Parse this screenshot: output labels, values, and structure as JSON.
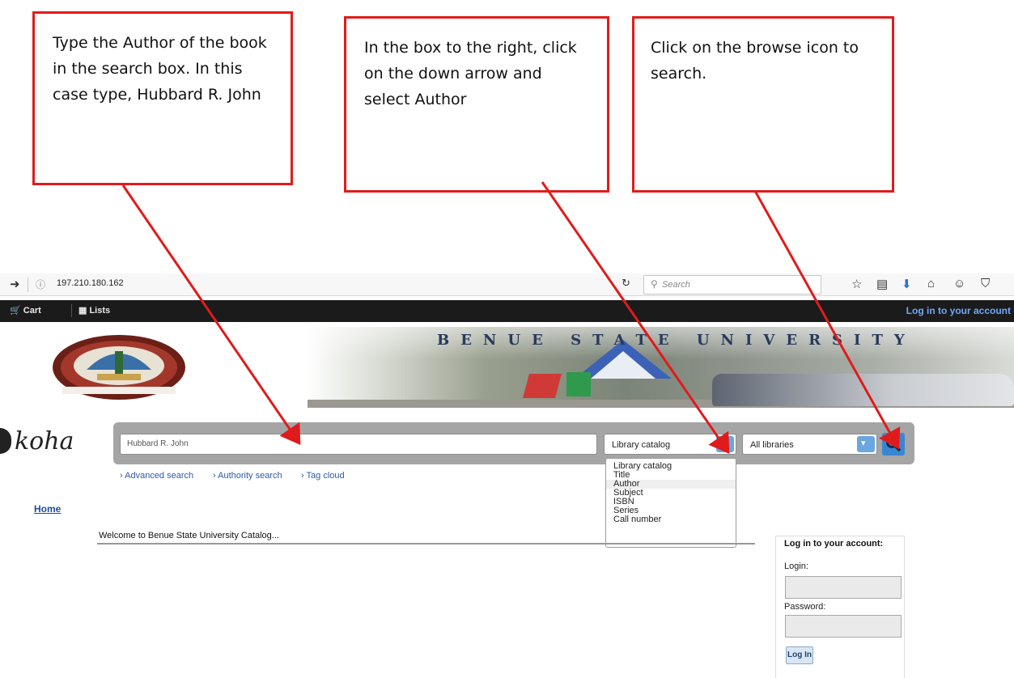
{
  "callouts": {
    "author_search": "Type the Author of the book in the search box. In this case type, Hubbard R. John",
    "select_author": "In the box to the right, click on the down arrow and select Author",
    "browse_icon": "Click on the browse icon to search."
  },
  "browser": {
    "url": "197.210.180.162",
    "search_placeholder": "Search",
    "toolbar_icons": [
      "forward-icon",
      "info-icon",
      "reload-icon",
      "bookmark-star-icon",
      "reading-list-icon",
      "download-icon",
      "home-icon",
      "chat-icon",
      "pocket-icon"
    ]
  },
  "topbar": {
    "cart": "Cart",
    "lists": "Lists",
    "login": "Log in to your account"
  },
  "banner": {
    "title": "BENUE STATE UNIVERSITY"
  },
  "search": {
    "logo": "koha",
    "query": "Hubbard R. John",
    "catalog_selected": "Library catalog",
    "libraries_selected": "All libraries",
    "links": {
      "advanced": "Advanced search",
      "authority": "Authority search",
      "tag_cloud": "Tag cloud"
    },
    "dropdown_options": [
      "Library catalog",
      "Title",
      "Author",
      "Subject",
      "ISBN",
      "Series",
      "Call number"
    ],
    "highlighted_option": "Author"
  },
  "body": {
    "home": "Home",
    "welcome": "Welcome to Benue State University Catalog..."
  },
  "login_panel": {
    "title": "Log in to your account:",
    "login_label": "Login:",
    "password_label": "Password:",
    "button": "Log In"
  },
  "colors": {
    "callout_border": "#e01b1b",
    "arrow": "#e01b1b",
    "topbar": "#1b1b1b",
    "link": "#2d5aa6",
    "search_bar": "#a5a5a5",
    "go_button": "#3a86d2"
  }
}
